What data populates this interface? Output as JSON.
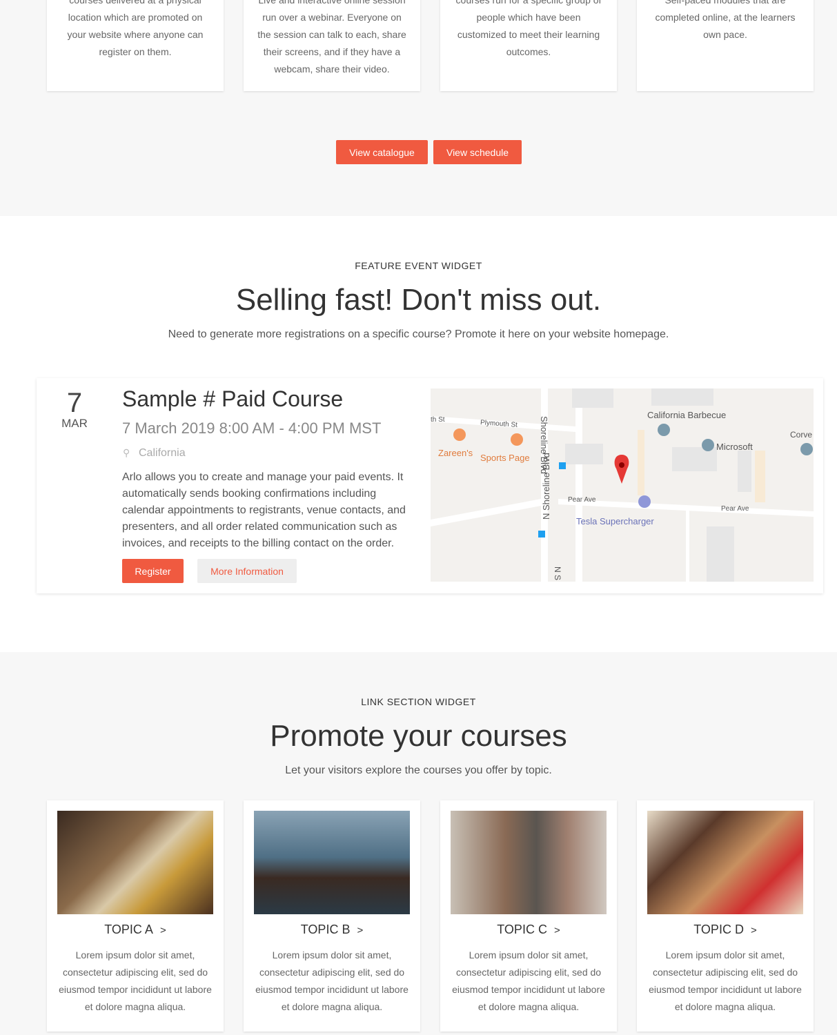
{
  "top_cards": [
    {
      "text": "courses delivered at a physical location which are promoted on your website where anyone can register on them."
    },
    {
      "text": "Live and interactive online session run over a webinar. Everyone on the session can talk to each, share their screens, and if they have a webcam, share their video."
    },
    {
      "text": "courses run for a specific group of people which have been customized to meet their learning outcomes."
    },
    {
      "text": "Self-paced modules that are completed online, at the learners own pace."
    }
  ],
  "buttons": {
    "catalogue": "View catalogue",
    "schedule": "View schedule"
  },
  "feature": {
    "eyebrow": "FEATURE EVENT WIDGET",
    "title": "Selling fast! Don't miss out.",
    "subtitle": "Need to generate more registrations on a specific course? Promote it here on your website homepage.",
    "event": {
      "day": "7",
      "month": "MAR",
      "name": "Sample # Paid Course",
      "datetime": "7 March 2019 8:00 AM - 4:00 PM MST",
      "location": "California",
      "description": "Arlo allows you to create and manage your paid events. It automatically sends booking confirmations including calendar appointments to registrants, venue contacts, and presenters, and all order related communication such as invoices, and receipts to the billing contact on the order.",
      "register": "Register",
      "more": "More Information"
    },
    "map": {
      "labels": [
        "th St",
        "Plymouth St",
        "Shoreline Blvd",
        "N Shoreline Blvd",
        "Zareen's",
        "Sports Page",
        "California Barbecue",
        "Microsoft",
        "Corve",
        "Pear Ave",
        "Pear Ave",
        "Tesla Supercharger",
        "N S"
      ]
    }
  },
  "links": {
    "eyebrow": "LINK SECTION WIDGET",
    "title": "Promote your courses",
    "subtitle": "Let your visitors explore the courses you offer by topic.",
    "topics": [
      {
        "title": "TOPIC A",
        "arrow": ">",
        "text": "Lorem ipsum dolor sit amet, consectetur adipiscing elit, sed do eiusmod tempor incididunt ut labore et dolore magna aliqua."
      },
      {
        "title": "TOPIC B",
        "arrow": ">",
        "text": "Lorem ipsum dolor sit amet, consectetur adipiscing elit, sed do eiusmod tempor incididunt ut labore et dolore magna aliqua."
      },
      {
        "title": "TOPIC C",
        "arrow": ">",
        "text": "Lorem ipsum dolor sit amet, consectetur adipiscing elit, sed do eiusmod tempor incididunt ut labore et dolore magna aliqua."
      },
      {
        "title": "TOPIC D",
        "arrow": ">",
        "text": "Lorem ipsum dolor sit amet, consectetur adipiscing elit, sed do eiusmod tempor incididunt ut labore et dolore magna aliqua."
      }
    ]
  },
  "colors": {
    "accent": "#f05a40",
    "pin": "#e53935"
  }
}
